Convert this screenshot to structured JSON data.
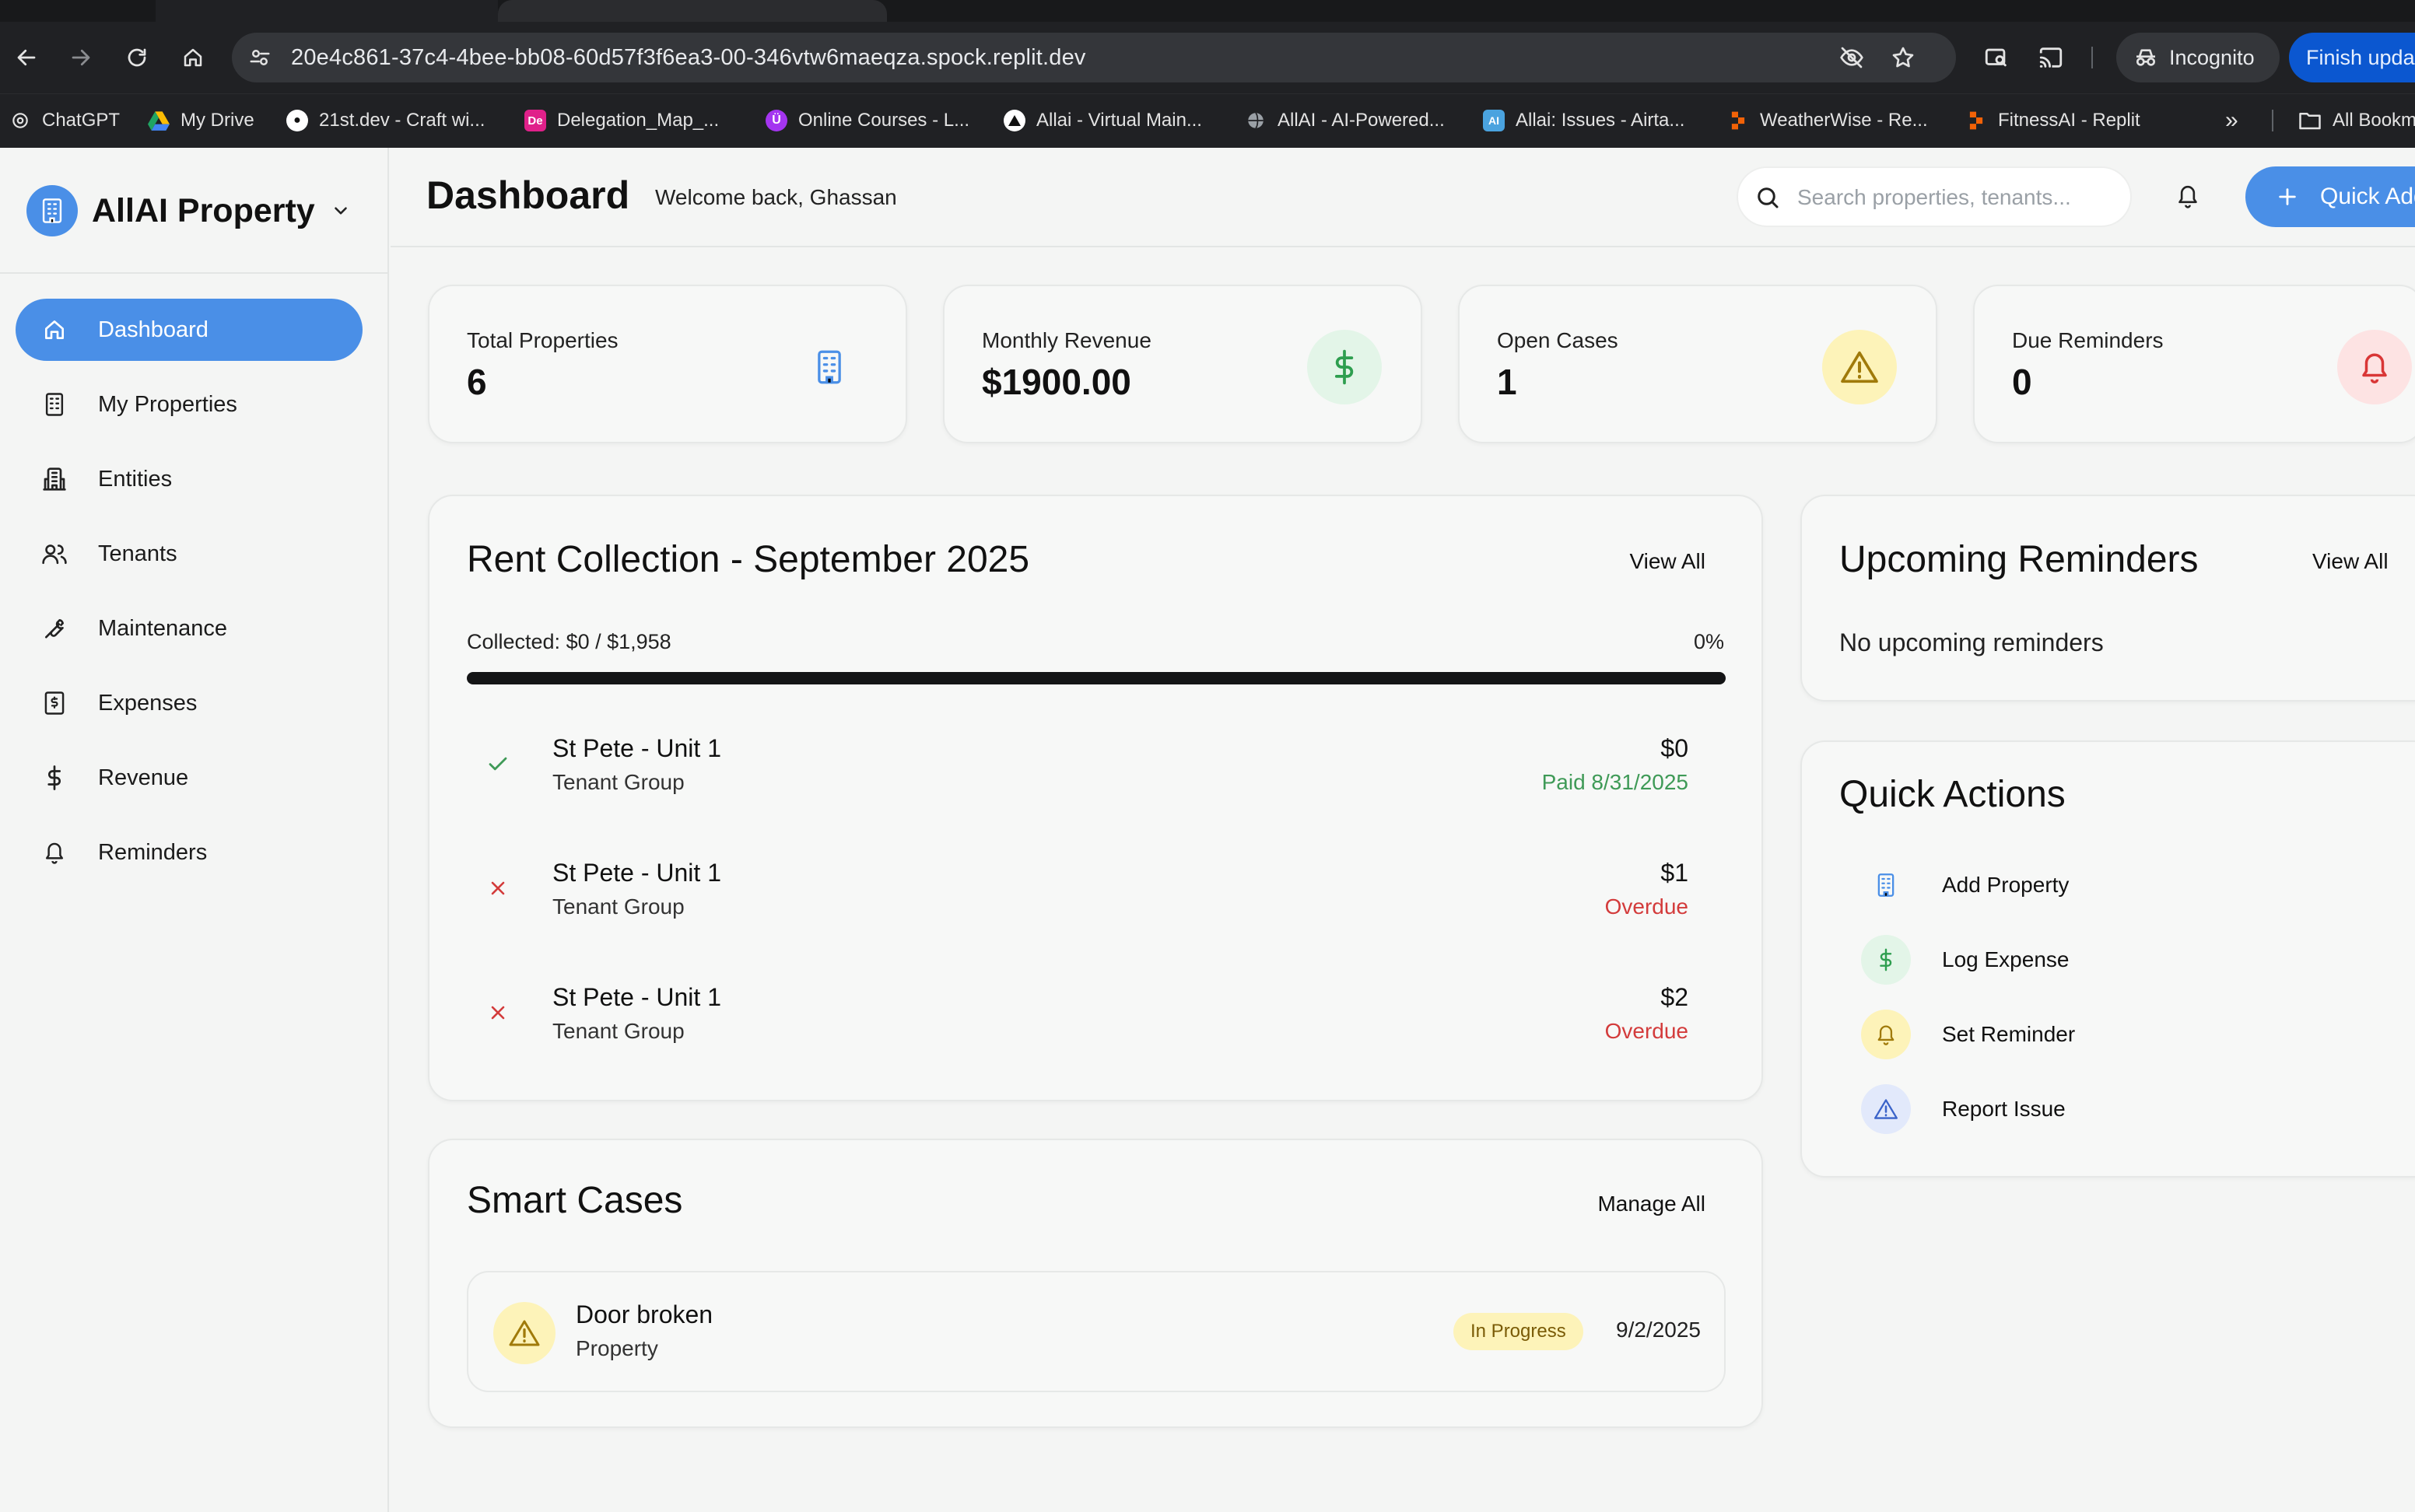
{
  "browser": {
    "url": "20e4c861-37c4-4bee-bb08-60d57f3f6ea3-00-346vtw6maeqza.spock.replit.dev",
    "incognito_label": "Incognito",
    "finish_update_label": "Finish upda",
    "bookmarks": [
      {
        "label": "ChatGPT",
        "icon": "chatgpt-icon",
        "color": "#3c3c3c"
      },
      {
        "label": "My Drive",
        "icon": "google-drive-icon",
        "color": "#1fa463"
      },
      {
        "label": "21st.dev - Craft wi...",
        "icon": "21st-dev-icon",
        "color": "#ffffff"
      },
      {
        "label": "Delegation_Map_...",
        "icon": "adobe-doc-icon",
        "color": "#e0218a"
      },
      {
        "label": "Online Courses - L...",
        "icon": "udemy-icon",
        "color": "#a435f0"
      },
      {
        "label": "Allai - Virtual Main...",
        "icon": "triangle-logo-icon",
        "color": "#ffffff"
      },
      {
        "label": "AllAI - AI-Powered...",
        "icon": "globe-icon",
        "color": "#9aa0a6"
      },
      {
        "label": "Allai: Issues - Airta...",
        "icon": "ai-square-icon",
        "color": "#4aa3df"
      },
      {
        "label": "WeatherWise - Re...",
        "icon": "replit-icon",
        "color": "#f26207"
      },
      {
        "label": "FitnessAI - Replit",
        "icon": "replit-icon",
        "color": "#f26207"
      }
    ],
    "bookmarks_overflow": "»",
    "all_bookmarks_label": "All Bookm"
  },
  "sidebar": {
    "brand_name": "AllAI Property",
    "items": [
      {
        "label": "Dashboard",
        "icon": "home-icon",
        "active": true
      },
      {
        "label": "My Properties",
        "icon": "building-icon",
        "active": false
      },
      {
        "label": "Entities",
        "icon": "entities-building-icon",
        "active": false
      },
      {
        "label": "Tenants",
        "icon": "users-icon",
        "active": false
      },
      {
        "label": "Maintenance",
        "icon": "wrench-icon",
        "active": false
      },
      {
        "label": "Expenses",
        "icon": "receipt-icon",
        "active": false
      },
      {
        "label": "Revenue",
        "icon": "dollar-icon",
        "active": false
      },
      {
        "label": "Reminders",
        "icon": "bell-icon",
        "active": false
      }
    ]
  },
  "header": {
    "title": "Dashboard",
    "welcome": "Welcome back, Ghassan",
    "search_placeholder": "Search properties, tenants...",
    "quick_add_label": "Quick Add"
  },
  "stats": [
    {
      "label": "Total Properties",
      "value": "6",
      "icon": "building-icon",
      "icon_color": "#4a8fe7",
      "bg": "transparent"
    },
    {
      "label": "Monthly Revenue",
      "value": "$1900.00",
      "icon": "dollar-icon",
      "icon_color": "#2e9e4f",
      "bg": "#e3f5e8"
    },
    {
      "label": "Open Cases",
      "value": "1",
      "icon": "warning-icon",
      "icon_color": "#a07a0a",
      "bg": "#fdf3b9"
    },
    {
      "label": "Due Reminders",
      "value": "0",
      "icon": "bell-icon",
      "icon_color": "#d93636",
      "bg": "#fde3e3"
    }
  ],
  "rent": {
    "title": "Rent Collection - September 2025",
    "view_all": "View All",
    "collected": "Collected: $0 / $1,958",
    "percent_label": "0%",
    "progress": 0,
    "rows": [
      {
        "title": "St Pete - Unit 1",
        "subtitle": "Tenant Group",
        "amount": "$0",
        "status": "Paid 8/31/2025",
        "paid": true
      },
      {
        "title": "St Pete - Unit 1",
        "subtitle": "Tenant Group",
        "amount": "$1",
        "status": "Overdue",
        "paid": false
      },
      {
        "title": "St Pete - Unit 1",
        "subtitle": "Tenant Group",
        "amount": "$2",
        "status": "Overdue",
        "paid": false
      }
    ],
    "colors": {
      "paid": "#3f9a57",
      "overdue": "#d33b3b"
    }
  },
  "cases": {
    "title": "Smart Cases",
    "manage_all": "Manage All",
    "items": [
      {
        "title": "Door broken",
        "subtitle": "Property",
        "badge": "In Progress",
        "date": "9/2/2025",
        "icon": "warning-icon"
      }
    ]
  },
  "reminders": {
    "title": "Upcoming Reminders",
    "view_all": "View All",
    "empty": "No upcoming reminders"
  },
  "quick_actions": {
    "title": "Quick Actions",
    "items": [
      {
        "label": "Add Property",
        "icon": "building-icon",
        "color": "#4a8fe7",
        "bg": "transparent"
      },
      {
        "label": "Log Expense",
        "icon": "dollar-icon",
        "color": "#2e9e4f",
        "bg": "#e3f5e8"
      },
      {
        "label": "Set Reminder",
        "icon": "bell-icon",
        "color": "#a07a0a",
        "bg": "#fdf3b9"
      },
      {
        "label": "Report Issue",
        "icon": "warning-icon",
        "color": "#3a63c9",
        "bg": "#e2e9fb"
      }
    ]
  },
  "colors": {
    "accent": "#4a8fe7"
  }
}
